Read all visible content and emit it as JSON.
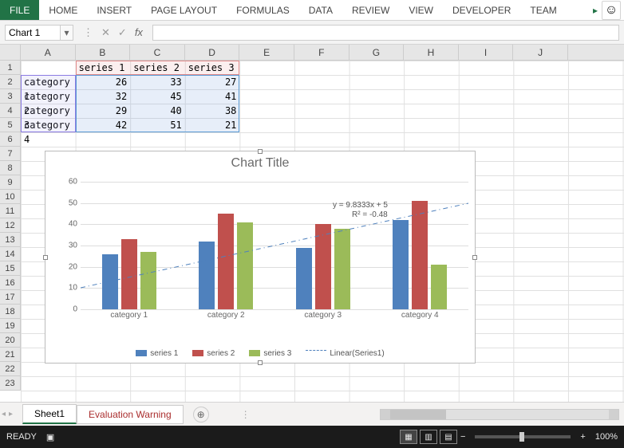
{
  "ribbon": {
    "tabs": [
      "FILE",
      "HOME",
      "INSERT",
      "PAGE LAYOUT",
      "FORMULAS",
      "DATA",
      "REVIEW",
      "VIEW",
      "DEVELOPER",
      "TEAM"
    ]
  },
  "name_box": "Chart 1",
  "formula": "",
  "columns": [
    "A",
    "B",
    "C",
    "D",
    "E",
    "F",
    "G",
    "H",
    "I",
    "J"
  ],
  "rows": [
    "1",
    "2",
    "3",
    "4",
    "5",
    "6",
    "7",
    "8",
    "9",
    "10",
    "11",
    "12",
    "13",
    "14",
    "15",
    "16",
    "17",
    "18",
    "19",
    "20",
    "21",
    "22",
    "23"
  ],
  "cells": {
    "B1": "series 1",
    "C1": "series 2",
    "D1": "series 3",
    "A2": "category 1",
    "B2": "26",
    "C2": "33",
    "D2": "27",
    "A3": "category 2",
    "B3": "32",
    "C3": "45",
    "D3": "41",
    "A4": "category 3",
    "B4": "29",
    "C4": "40",
    "D4": "38",
    "A5": "category 4",
    "B5": "42",
    "C5": "51",
    "D5": "21"
  },
  "chart_data": {
    "type": "bar",
    "title": "Chart Title",
    "categories": [
      "category 1",
      "category 2",
      "category 3",
      "category 4"
    ],
    "series": [
      {
        "name": "series 1",
        "values": [
          26,
          32,
          29,
          42
        ],
        "color": "#4f81bd"
      },
      {
        "name": "series 2",
        "values": [
          33,
          45,
          40,
          51
        ],
        "color": "#c0504d"
      },
      {
        "name": "series 3",
        "values": [
          27,
          41,
          38,
          21
        ],
        "color": "#9bbb59"
      }
    ],
    "yticks": [
      0,
      10,
      20,
      30,
      40,
      50,
      60
    ],
    "ylim": [
      0,
      60
    ],
    "trendline": {
      "label": "Linear(Series1)",
      "equation": "y = 9.8333x + 5",
      "r2": "R² = -0.48"
    }
  },
  "sheet_tabs": [
    "Sheet1",
    "Evaluation Warning"
  ],
  "status": {
    "ready": "READY",
    "zoom": "100%"
  }
}
